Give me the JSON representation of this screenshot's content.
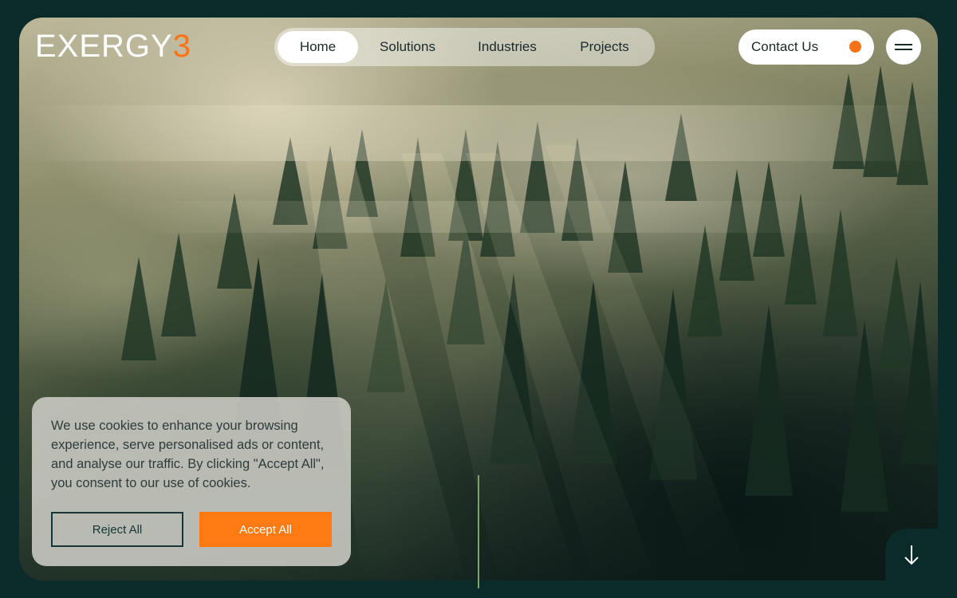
{
  "brand": {
    "logo_text": "EXERGY",
    "logo_accent": "3",
    "accent_color": "#f97316"
  },
  "nav": {
    "items": [
      {
        "label": "Home",
        "active": true
      },
      {
        "label": "Solutions",
        "active": false
      },
      {
        "label": "Industries",
        "active": false
      },
      {
        "label": "Projects",
        "active": false
      }
    ]
  },
  "header": {
    "contact_label": "Contact Us",
    "menu_icon": "hamburger-menu-icon"
  },
  "hero": {
    "background": "misty forest aerial photograph",
    "scroll_icon": "arrow-down-icon"
  },
  "cookie_banner": {
    "message": "We use cookies to enhance your browsing experience, serve personalised ads or content, and analyse our traffic. By clicking \"Accept All\", you consent to our use of cookies.",
    "reject_label": "Reject All",
    "accept_label": "Accept All"
  },
  "colors": {
    "page_bg": "#0b2b2b",
    "accept_button": "#ff7a12",
    "accent_line": "#7fa26a"
  }
}
